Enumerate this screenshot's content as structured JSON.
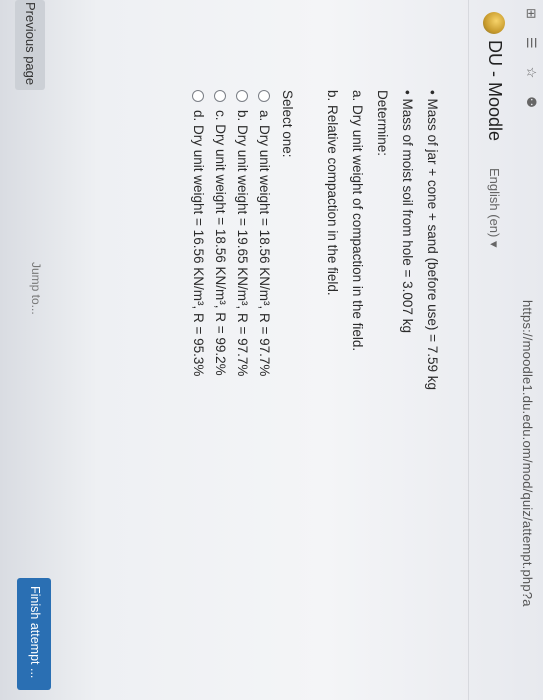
{
  "browser": {
    "url": "https://moodle1.du.edu.om/mod/quiz/attempt.php?a",
    "icons": [
      "window-icon",
      "reading-list-icon",
      "star-icon",
      "profile-icon"
    ]
  },
  "header": {
    "site_title": "DU - Moodle",
    "language": "English (en)"
  },
  "question": {
    "lines": [
      "• Mass of jar + cone + sand (before use) = 7.59 kg",
      "• Mass of moist soil from hole = 3.007 kg",
      "Determine:",
      "a. Dry unit weight of compaction in the field.",
      "b. Relative compaction in the field."
    ],
    "select_label": "Select one:",
    "options": [
      {
        "label": "a. Dry unit weight = 18.56 KN/m³, R = 97.7%"
      },
      {
        "label": "b. Dry unit weight = 19.65 KN/m³, R = 97.7%"
      },
      {
        "label": "c. Dry unit weight = 18.56 KN/m³, R = 99.2%"
      },
      {
        "label": "d. Dry unit weight = 16.56 KN/m³, R = 95.3%"
      }
    ]
  },
  "navigation": {
    "previous_page": "Previous page",
    "jump_to": "Jump to...",
    "finish_attempt": "Finish attempt ..."
  }
}
